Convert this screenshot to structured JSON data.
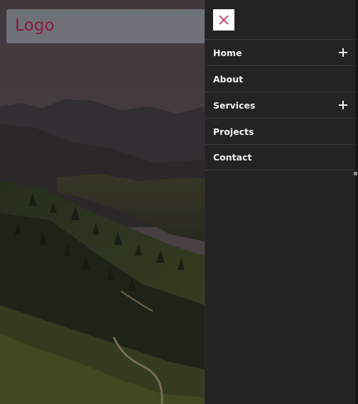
{
  "header": {
    "logo_text": "Logo"
  },
  "menu": {
    "close_icon": "close-icon",
    "items": [
      {
        "label": "Home",
        "has_submenu": true
      },
      {
        "label": "About",
        "has_submenu": false
      },
      {
        "label": "Services",
        "has_submenu": true
      },
      {
        "label": "Projects",
        "has_submenu": false
      },
      {
        "label": "Contact",
        "has_submenu": false
      }
    ]
  },
  "colors": {
    "logo": "#8a1b3d",
    "close_x": "#c0315f",
    "menu_bg": "#232323",
    "menu_text": "#f2f2f2"
  }
}
